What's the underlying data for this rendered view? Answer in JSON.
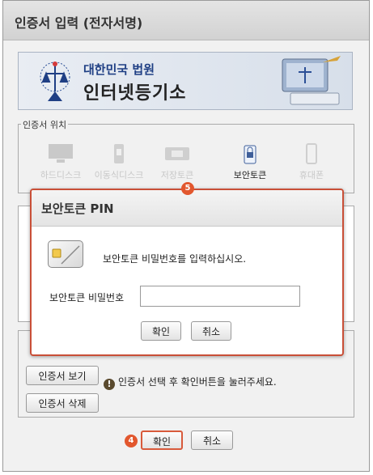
{
  "window": {
    "title": "인증서 입력 (전자서명)"
  },
  "banner": {
    "line1": "대한민국 법원",
    "line2": "인터넷등기소"
  },
  "location": {
    "legend": "인증서 위치",
    "devices": [
      {
        "label": "하드디스크",
        "active": false
      },
      {
        "label": "이동식디스크",
        "active": false
      },
      {
        "label": "저장토큰",
        "active": false
      },
      {
        "label": "보안토큰",
        "active": true
      },
      {
        "label": "휴대폰",
        "active": false
      }
    ]
  },
  "cert_buttons": {
    "view": "인증서 보기",
    "delete": "인증서 삭제"
  },
  "hint": "인증서 선택 후 확인버튼을 눌러주세요.",
  "footer": {
    "ok": "확인",
    "cancel": "취소",
    "step_badge": "4"
  },
  "dialog": {
    "title": "보안토큰 PIN",
    "message": "보안토큰 비밀번호를 입력하십시오.",
    "pin_label": "보안토큰 비밀번호",
    "pin_value": "",
    "ok": "확인",
    "cancel": "취소",
    "step_badge": "5"
  },
  "colors": {
    "accent": "#e2572e",
    "brand_blue": "#1f3f84"
  }
}
